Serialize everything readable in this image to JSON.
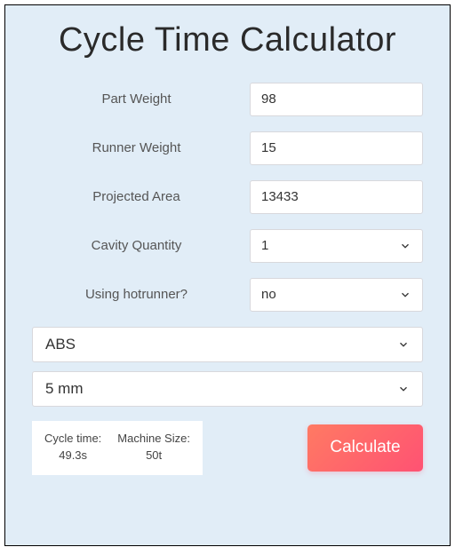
{
  "title": "Cycle Time Calculator",
  "fields": {
    "part_weight": {
      "label": "Part Weight",
      "value": "98"
    },
    "runner_weight": {
      "label": "Runner Weight",
      "value": "15"
    },
    "projected_area": {
      "label": "Projected Area",
      "value": "13433"
    },
    "cavity_quantity": {
      "label": "Cavity Quantity",
      "value": "1"
    },
    "hotrunner": {
      "label": "Using hotrunner?",
      "value": "no"
    }
  },
  "material": {
    "value": "ABS"
  },
  "thickness": {
    "value": "5 mm"
  },
  "results": {
    "cycle_time": {
      "label": "Cycle time:",
      "value": "49.3s"
    },
    "machine_size": {
      "label": "Machine Size:",
      "value": "50t"
    }
  },
  "calculate_label": "Calculate"
}
